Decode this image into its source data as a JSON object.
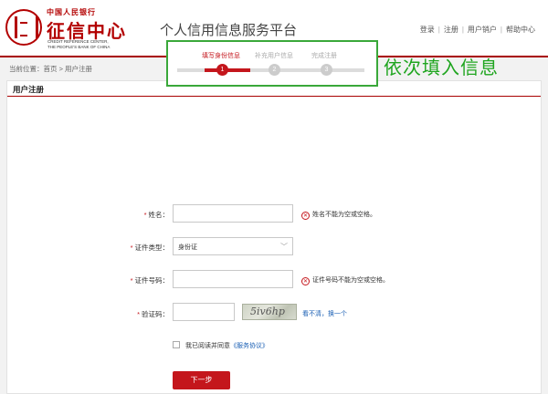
{
  "header": {
    "logo_top": "中国人民银行",
    "logo_main": "征信中心",
    "logo_sub1": "CREDIT REFERENCE CENTER,",
    "logo_sub2": "THE PEOPLE'S BANK OF CHINA",
    "platform_title": "个人信用信息服务平台",
    "nav": {
      "login": "登录",
      "register": "注册",
      "logout": "用户销户",
      "help": "帮助中心",
      "sep": "|"
    }
  },
  "breadcrumb": "当前位置：首页 > 用户注册",
  "panel_title": "用户注册",
  "steps": [
    {
      "label": "填写身份信息",
      "number": "1",
      "active": true
    },
    {
      "label": "补充用户信息",
      "number": "2",
      "active": false
    },
    {
      "label": "完成注册",
      "number": "3",
      "active": false
    }
  ],
  "annotation": "依次填入信息",
  "form": {
    "required_mark": "*",
    "name_label": "姓名：",
    "name_value": "",
    "name_error": "姓名不能为空或空格。",
    "idtype_label": "证件类型：",
    "idtype_value": "身份证",
    "idnum_label": "证件号码：",
    "idnum_value": "",
    "idnum_error": "证件号码不能为空或空格。",
    "captcha_label": "验证码：",
    "captcha_value": "",
    "captcha_image_text": "5iv6hp",
    "captcha_refresh": "看不清，换一个",
    "agree_text": "我已阅读并同意",
    "agree_link": "《服务协议》",
    "next_button": "下一步"
  },
  "colors": {
    "brand_red": "#c4161c",
    "annotation_green": "#1fa51f",
    "link_blue": "#1a5fb4"
  }
}
